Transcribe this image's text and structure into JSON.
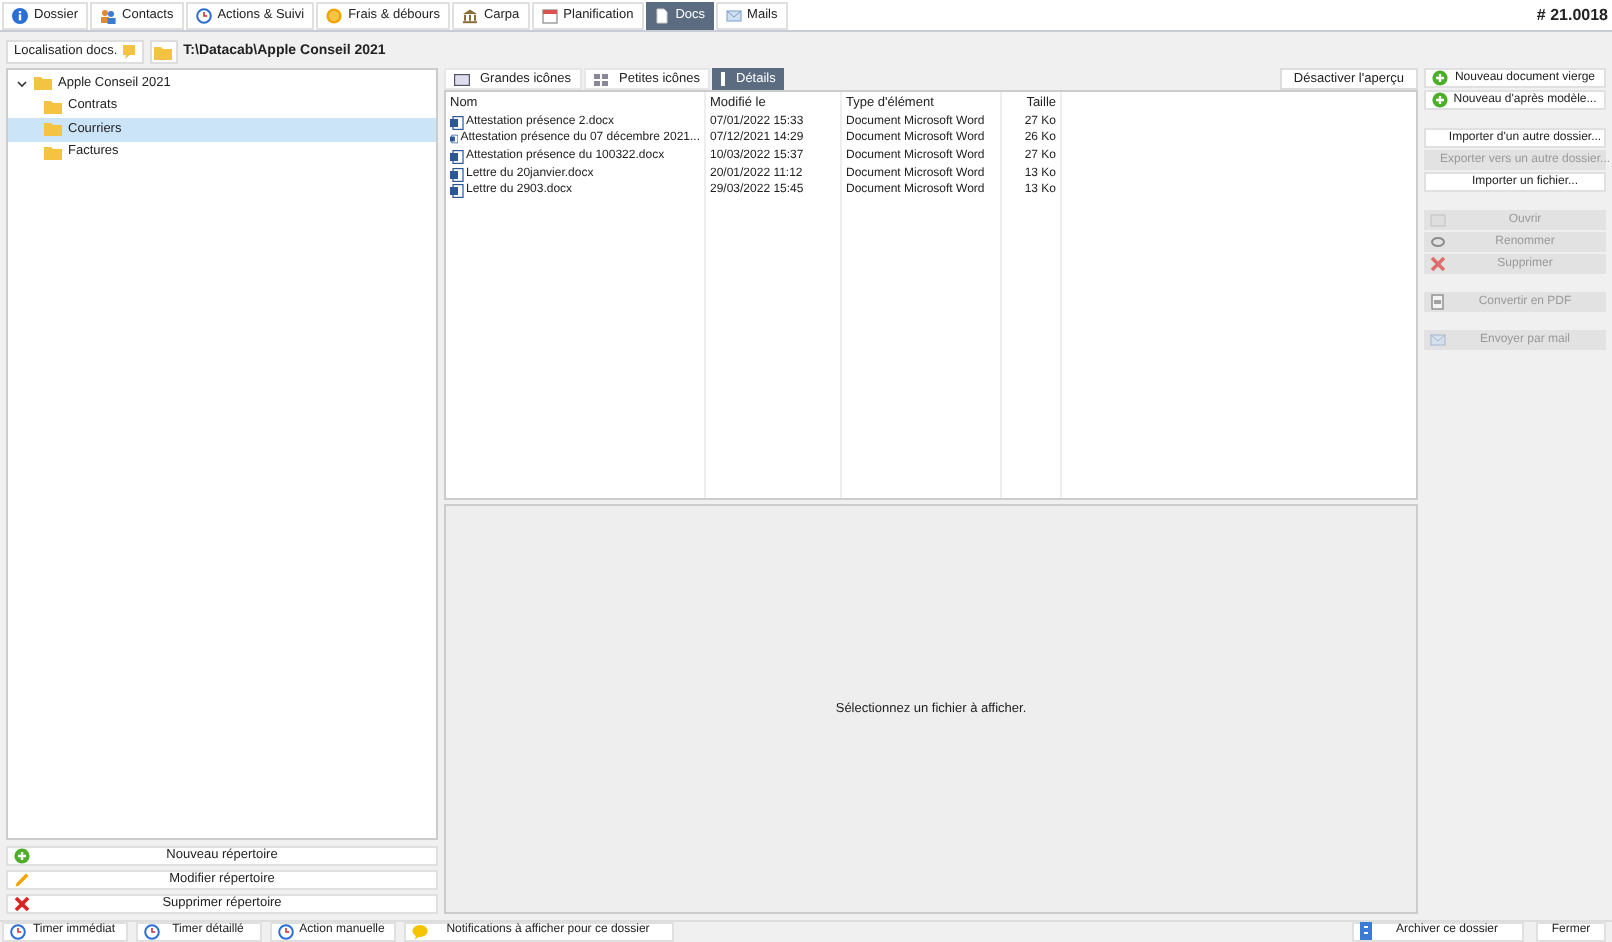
{
  "tabs": [
    {
      "label": "Dossier",
      "selected": false
    },
    {
      "label": "Contacts",
      "selected": false
    },
    {
      "label": "Actions & Suivi",
      "selected": false
    },
    {
      "label": "Frais & débours",
      "selected": false
    },
    {
      "label": "Carpa",
      "selected": false
    },
    {
      "label": "Planification",
      "selected": false
    },
    {
      "label": "Docs",
      "selected": true
    },
    {
      "label": "Mails",
      "selected": false
    }
  ],
  "case_number": "# 21.0018",
  "location": {
    "button": "Localisation docs.",
    "path": "T:\\Datacab\\Apple Conseil 2021"
  },
  "tree": [
    {
      "label": "Apple Conseil 2021",
      "expanded": true,
      "selected": false,
      "children": [
        {
          "label": "Contrats",
          "selected": false
        },
        {
          "label": "Courriers",
          "selected": true
        },
        {
          "label": "Factures",
          "selected": false
        }
      ]
    }
  ],
  "folder_buttons": [
    "Nouveau répertoire",
    "Modifier répertoire",
    "Supprimer répertoire"
  ],
  "view_tabs": [
    {
      "label": "Grandes icônes",
      "selected": false
    },
    {
      "label": "Petites icônes",
      "selected": false
    },
    {
      "label": "Détails",
      "selected": true
    }
  ],
  "preview_toggle": "Désactiver l'aperçu",
  "table": {
    "columns": [
      "Nom",
      "Modifié le",
      "Type d'élément",
      "Taille"
    ],
    "rows": [
      [
        "Attestation présence 2.docx",
        "07/01/2022 15:33",
        "Document Microsoft Word",
        "27 Ko"
      ],
      [
        "Attestation présence du 07 décembre 2021...",
        "07/12/2021 14:29",
        "Document Microsoft Word",
        "26 Ko"
      ],
      [
        "Attestation présence du 100322.docx",
        "10/03/2022 15:37",
        "Document Microsoft Word",
        "27 Ko"
      ],
      [
        "Lettre du 20janvier.docx",
        "20/01/2022 11:12",
        "Document Microsoft Word",
        "13 Ko"
      ],
      [
        "Lettre du 2903.docx",
        "29/03/2022 15:45",
        "Document Microsoft Word",
        "13 Ko"
      ]
    ]
  },
  "preview_message": "Sélectionnez un fichier à afficher.",
  "actions": [
    {
      "label": "Nouveau document vierge",
      "disabled": false
    },
    {
      "label": "Nouveau d'après modèle...",
      "disabled": false
    },
    {
      "label": "Importer d'un autre dossier...",
      "disabled": false
    },
    {
      "label": "Exporter vers un autre dossier...",
      "disabled": true
    },
    {
      "label": "Importer un fichier...",
      "disabled": false
    },
    {
      "label": "Ouvrir",
      "disabled": true
    },
    {
      "label": "Renommer",
      "disabled": true
    },
    {
      "label": "Supprimer",
      "disabled": true
    },
    {
      "label": "Convertir en PDF",
      "disabled": true
    },
    {
      "label": "Envoyer par mail",
      "disabled": true
    }
  ],
  "footer_left": [
    "Timer immédiat",
    "Timer détaillé",
    "Action manuelle",
    "Notifications à afficher pour ce dossier"
  ],
  "footer_right": [
    "Archiver ce dossier",
    "Fermer"
  ]
}
